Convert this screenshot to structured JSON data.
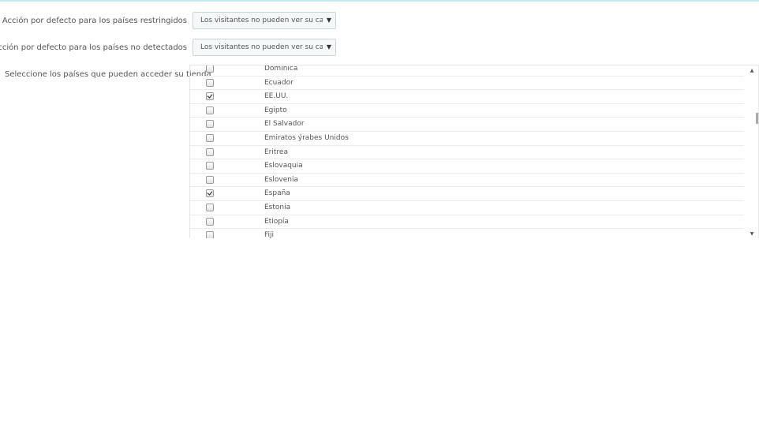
{
  "form": {
    "restricted": {
      "label": "Acción por defecto para los países restringidos",
      "value": "Los visitantes no pueden ver su catálogo"
    },
    "undetected": {
      "label": "Acción por defecto para los países no detectados",
      "value": "Los visitantes no pueden ver su catálogo"
    },
    "countries_label": "Seleccione los países que pueden acceder su tienda"
  },
  "countries": [
    {
      "name": "Dominica",
      "checked": false
    },
    {
      "name": "Ecuador",
      "checked": false
    },
    {
      "name": "EE.UU.",
      "checked": true
    },
    {
      "name": "Egipto",
      "checked": false
    },
    {
      "name": "El Salvador",
      "checked": false
    },
    {
      "name": "Emiratos ýrabes Unidos",
      "checked": false
    },
    {
      "name": "Eritrea",
      "checked": false
    },
    {
      "name": "Eslovaquia",
      "checked": false
    },
    {
      "name": "Eslovenia",
      "checked": false
    },
    {
      "name": "España",
      "checked": true
    },
    {
      "name": "Estonia",
      "checked": false
    },
    {
      "name": "Etiopía",
      "checked": false
    },
    {
      "name": "Fiji",
      "checked": false
    }
  ],
  "icons": {
    "caret": "caret-down-icon",
    "scroll_up": "scroll-up-arrow-icon",
    "scroll_down": "scroll-down-arrow-icon"
  },
  "colors": {
    "top_accent": "#bfe9f5",
    "select_border": "#c7d6db"
  }
}
